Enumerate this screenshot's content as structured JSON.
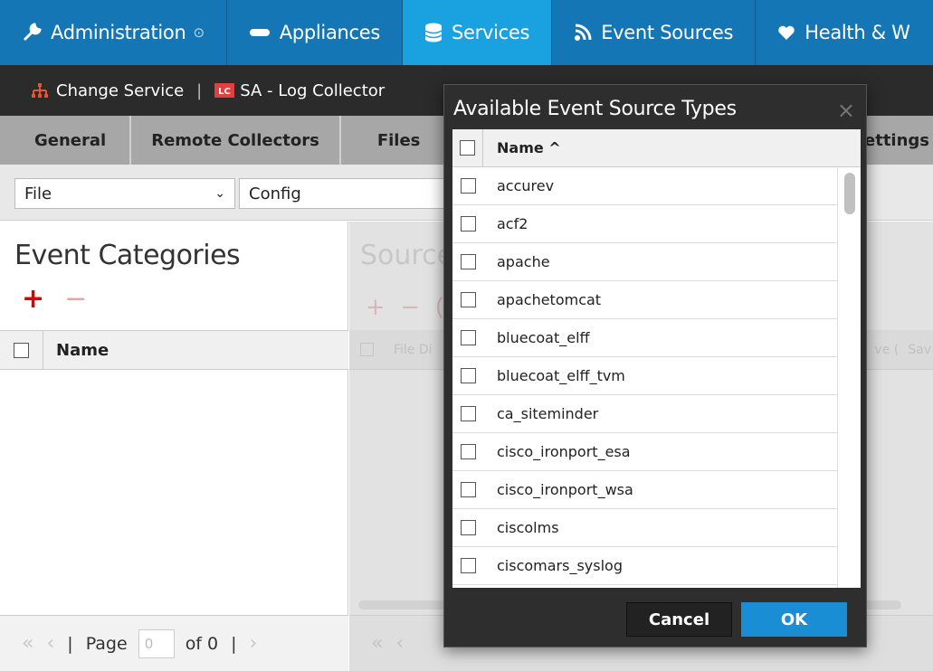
{
  "topnav": {
    "tabs": [
      {
        "label": "Administration",
        "icon": "wrench-icon",
        "dropdown": true
      },
      {
        "label": "Appliances",
        "icon": "appliance-icon"
      },
      {
        "label": "Services",
        "icon": "database-icon",
        "active": true
      },
      {
        "label": "Event Sources",
        "icon": "rss-icon"
      },
      {
        "label": "Health & W",
        "icon": "heart-icon"
      }
    ]
  },
  "subbar": {
    "change_service": "Change Service",
    "separator": "|",
    "service_name": "SA - Log Collector"
  },
  "subtabs": {
    "general": "General",
    "remote_collectors": "Remote Collectors",
    "files": "Files",
    "settings_partial": "ettings"
  },
  "toolbar": {
    "file_select": "File",
    "config_select": "Config"
  },
  "left_panel": {
    "title": "Event Categories",
    "column_name": "Name",
    "pager": {
      "page_label": "Page",
      "page_value": "0",
      "of_label": "of 0",
      "sep": "|"
    }
  },
  "background_panel": {
    "title": "Source",
    "col_file": "File Di",
    "col_save1": "ve (",
    "col_save2": "Sav"
  },
  "modal": {
    "title": "Available Event Source Types",
    "close": "×",
    "column_name": "Name ^",
    "items": [
      "accurev",
      "acf2",
      "apache",
      "apachetomcat",
      "bluecoat_elff",
      "bluecoat_elff_tvm",
      "ca_siteminder",
      "cisco_ironport_esa",
      "cisco_ironport_wsa",
      "ciscolms",
      "ciscomars_syslog"
    ],
    "cancel": "Cancel",
    "ok": "OK"
  },
  "colors": {
    "topnav": "#1476b4",
    "active_tab": "#1aa1e0",
    "subbar": "#2b2b2b",
    "ok_button": "#1a8ed4",
    "add_icon": "#e00000"
  }
}
